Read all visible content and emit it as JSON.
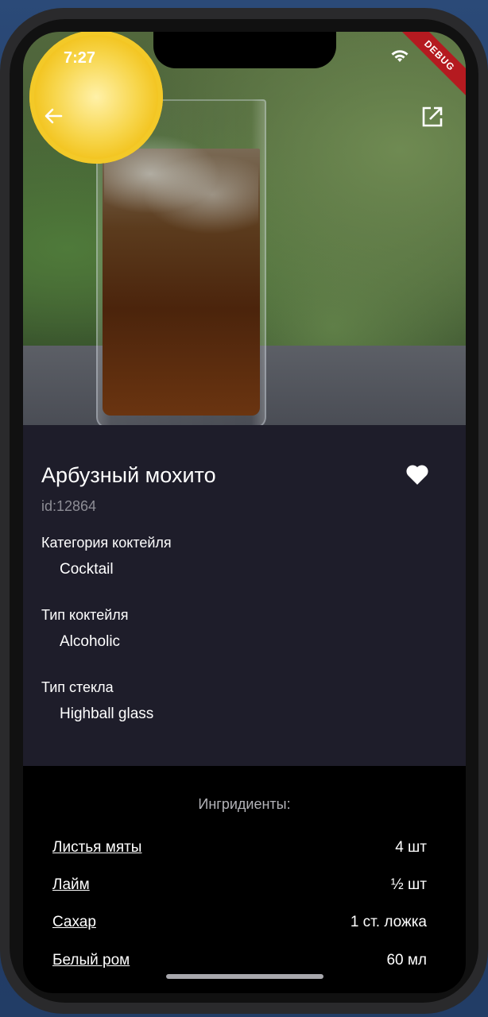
{
  "status_bar": {
    "time": "7:27",
    "debug_banner": "DEBUG"
  },
  "toolbar": {
    "back_icon": "arrow-left-icon",
    "open_icon": "open-external-icon"
  },
  "cocktail": {
    "name": "Арбузный мохито",
    "id_text": "id:12864",
    "favorite_icon": "heart-icon"
  },
  "fields": [
    {
      "label": "Категория коктейля",
      "value": "Cocktail"
    },
    {
      "label": "Тип коктейля",
      "value": "Alcoholic"
    },
    {
      "label": "Тип стекла",
      "value": "Highball glass"
    }
  ],
  "ingredients": {
    "title": "Ингридиенты:",
    "items": [
      {
        "name": "Листья мяты",
        "qty": "4 шт"
      },
      {
        "name": "Лайм",
        "qty": "½ шт"
      },
      {
        "name": "Сахар",
        "qty": "1 ст. ложка"
      },
      {
        "name": "Белый ром",
        "qty": "60 мл"
      }
    ]
  },
  "colors": {
    "info_background": "#1e1d2a",
    "screen_background": "#000000",
    "debug": "#b51a20"
  }
}
